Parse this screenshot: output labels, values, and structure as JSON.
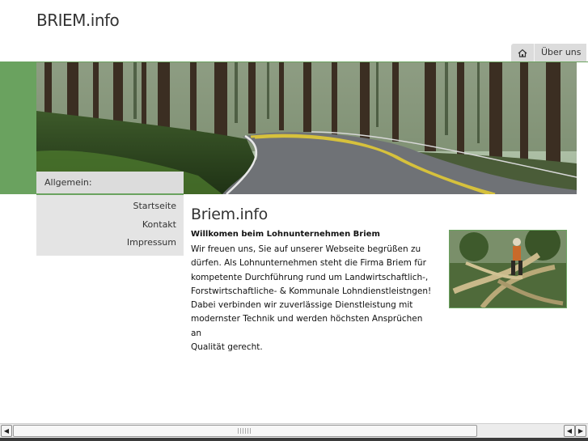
{
  "header": {
    "logo": "BRIEM.info"
  },
  "top_nav": {
    "home_icon": "home-icon",
    "items": [
      {
        "label": "Über uns"
      }
    ]
  },
  "sidebar": {
    "heading": "Allgemein:",
    "items": [
      {
        "label": "Startseite"
      },
      {
        "label": "Kontakt"
      },
      {
        "label": "Impressum"
      }
    ]
  },
  "main": {
    "title": "Briem.info",
    "welcome": "Willkomen beim Lohnunternehmen Briem",
    "lines": [
      "Wir freuen uns, Sie auf unserer Webseite begrüßen zu",
      "dürfen. Als Lohnunternehmen steht die Firma Briem für",
      "kompetente Durchführung rund um Landwirtschaftlich-,",
      "Forstwirtschaftliche- & Kommunale Lohndienstleistngen!",
      "Dabei verbinden wir zuverlässige Dienstleistung mit",
      "modernster Technik und werden höchsten Ansprüchen an",
      "Qualität gerecht."
    ]
  },
  "colors": {
    "accent_green": "#6aa25f",
    "nav_gray": "#dcdcdc"
  },
  "scrollbar": {
    "left_arrow": "◀",
    "right_arrow": "▶",
    "left_arrow_2": "◀"
  }
}
